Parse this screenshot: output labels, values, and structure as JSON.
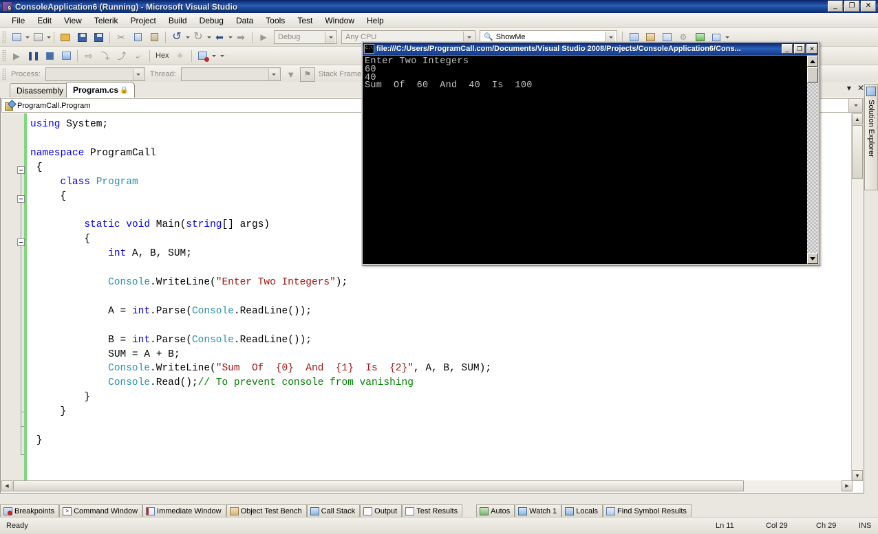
{
  "window": {
    "title": "ConsoleApplication6 (Running) - Microsoft Visual Studio",
    "minimize": "_",
    "restore": "❐",
    "close": "✕"
  },
  "menu": {
    "items": [
      "File",
      "Edit",
      "View",
      "Telerik",
      "Project",
      "Build",
      "Debug",
      "Data",
      "Tools",
      "Test",
      "Window",
      "Help"
    ]
  },
  "toolbar_standard": {
    "new_project_icon": "new-project-icon",
    "add_item_icon": "add-new-item-icon",
    "open_icon": "open-file-icon",
    "save_icon": "save-icon",
    "save_all_icon": "save-all-icon",
    "cut_icon": "cut-icon",
    "copy_icon": "copy-icon",
    "paste_icon": "paste-icon",
    "undo_icon": "undo-icon",
    "redo_icon": "redo-icon",
    "navigate_back_icon": "navigate-backward-icon",
    "navigate_fwd_icon": "navigate-forward-icon",
    "start_icon": "start-debugging-icon",
    "config_value": "Debug",
    "platform_value": "Any CPU",
    "showme_label": "ShowMe",
    "showme_icon": "showme-binoculars-icon"
  },
  "toolbar_debug": {
    "continue_icon": "continue-icon",
    "break_all_icon": "break-all-icon",
    "stop_icon": "stop-debugging-icon",
    "restart_icon": "restart-icon",
    "show_next_icon": "show-next-statement-icon",
    "step_into_icon": "step-into-icon",
    "step_over_icon": "step-over-icon",
    "step_out_icon": "step-out-icon",
    "hex_label": "Hex",
    "threads_icon": "threads-icon",
    "breakpoints_icon": "breakpoints-window-icon"
  },
  "toolbar_process": {
    "process_label": "Process:",
    "process_value": "",
    "thread_label": "Thread:",
    "thread_value": "",
    "stack_frame_label": "Stack Frame:",
    "filter_icon": "filter-icon",
    "flag_icon": "flag-icon"
  },
  "editor": {
    "tabs": [
      {
        "label": "Disassembly",
        "active": false,
        "locked": false
      },
      {
        "label": "Program.cs",
        "active": true,
        "locked": true
      }
    ],
    "tab_lock_glyph": "🔒",
    "tab_dropdown_glyph": "▾",
    "tab_close_glyph": "✕",
    "navbar_value": "ProgramCall.Program",
    "navbar_dropdown_glyph": "▾",
    "code_lines": [
      "using System;",
      "",
      "namespace ProgramCall",
      " {",
      "     class Program",
      "     {",
      "",
      "         static void Main(string[] args)",
      "         {",
      "             int A, B, SUM;",
      "",
      "             Console.WriteLine(\"Enter Two Integers\");",
      "",
      "             A = int.Parse(Console.ReadLine());",
      "",
      "             B = int.Parse(Console.ReadLine());",
      "             SUM = A + B;",
      "             Console.WriteLine(\"Sum  Of  {0}  And  {1}  Is  {2}\", A, B, SUM);",
      "             Console.Read();// To prevent console from vanishing",
      "         }",
      "     }",
      "",
      " }"
    ],
    "scroll_up_glyph": "▲",
    "scroll_down_glyph": "▼",
    "scroll_left_glyph": "◀",
    "scroll_right_glyph": "▶"
  },
  "solution_explorer": {
    "label": "Solution Explorer",
    "icon": "solution-explorer-icon"
  },
  "console": {
    "title": "file:///C:/Users/ProgramCall.com/Documents/Visual Studio 2008/Projects/ConsoleApplication6/Cons...",
    "icon": "console-window-icon",
    "minimize": "_",
    "maximize": "❐",
    "close": "✕",
    "output": "Enter Two Integers\n60\n40\nSum  Of  60  And  40  Is  100",
    "scroll_up_glyph": "▲",
    "scroll_down_glyph": "▼"
  },
  "bottom_tabs": {
    "left_group": [
      {
        "label": "Breakpoints",
        "icon": "breakpoints-icon"
      },
      {
        "label": "Command Window",
        "icon": "command-window-icon"
      },
      {
        "label": "Immediate Window",
        "icon": "immediate-window-icon"
      },
      {
        "label": "Object Test Bench",
        "icon": "object-test-bench-icon"
      },
      {
        "label": "Call Stack",
        "icon": "call-stack-icon"
      },
      {
        "label": "Output",
        "icon": "output-icon"
      },
      {
        "label": "Test Results",
        "icon": "test-results-icon"
      }
    ],
    "right_group": [
      {
        "label": "Autos",
        "icon": "autos-icon"
      },
      {
        "label": "Watch 1",
        "icon": "watch-icon"
      },
      {
        "label": "Locals",
        "icon": "locals-icon"
      },
      {
        "label": "Find Symbol Results",
        "icon": "find-symbol-results-icon"
      }
    ]
  },
  "statusbar": {
    "state": "Ready",
    "line": "Ln 11",
    "column": "Col 29",
    "character": "Ch 29",
    "insert_mode": "INS"
  },
  "colors": {
    "title_blue": "#0a246a",
    "keyword_blue": "#0000ff",
    "type_teal": "#2b91af",
    "string_red": "#a31515",
    "comment_green": "#008000",
    "change_bar_green": "#7fd87f",
    "chrome_beige": "#e9e7e0"
  }
}
